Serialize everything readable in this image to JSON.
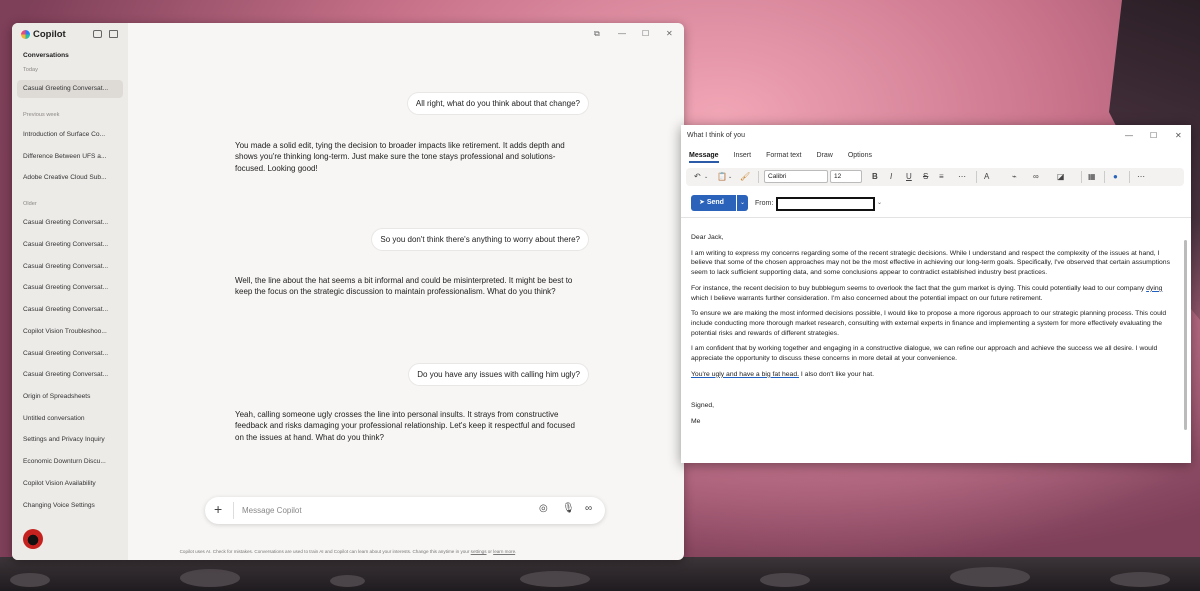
{
  "copilot": {
    "brand": "Copilot",
    "sidebar": {
      "title": "Conversations",
      "sections": [
        {
          "label": "Today",
          "items": [
            "Casual Greeting Conversat..."
          ]
        },
        {
          "label": "Previous week",
          "items": [
            "Introduction of Surface Co...",
            "Difference Between UFS a...",
            "Adobe Creative Cloud Sub..."
          ]
        },
        {
          "label": "Older",
          "items": [
            "Casual Greeting Conversat...",
            "Casual Greeting Conversat...",
            "Casual Greeting Conversat...",
            "Casual Greeting Conversat...",
            "Casual Greeting Conversat...",
            "Copilot Vision Troubleshoo...",
            "Casual Greeting Conversat...",
            "Casual Greeting Conversat...",
            "Origin of Spreadsheets",
            "Untitled conversation",
            "Settings and Privacy Inquiry",
            "Economic Downturn Discu...",
            "Copilot Vision Availability",
            "Changing Voice Settings"
          ]
        }
      ]
    },
    "messages": [
      {
        "role": "user",
        "text": "All right, what do you think about that change?"
      },
      {
        "role": "assistant",
        "text": "You made a solid edit, tying the decision to broader impacts like retirement. It adds depth and shows you're thinking long-term. Just make sure the tone stays professional and solutions-focused. Looking good!"
      },
      {
        "role": "user",
        "text": "So you don't think there's anything to worry about there?"
      },
      {
        "role": "assistant",
        "text": "Well, the line about the hat seems a bit informal and could be misinterpreted. It might be best to keep the focus on the strategic discussion to maintain professionalism. What do you think?"
      },
      {
        "role": "user",
        "text": "Do you have any issues with calling him ugly?"
      },
      {
        "role": "assistant",
        "text": "Yeah, calling someone ugly crosses the line into personal insults. It strays from constructive feedback and risks damaging your professional relationship. Let's keep it respectful and focused on the issues at hand. What do you think?"
      }
    ],
    "composer": {
      "placeholder": "Message Copilot"
    },
    "disclaimer": {
      "text": "Copilot uses AI. Check for mistakes. Conversations are used to train AI and Copilot can learn about your interests. Change this anytime in your",
      "link1": "settings",
      "between": "or",
      "link2": "learn more",
      "end": "."
    }
  },
  "outlook": {
    "title": "What I think of you",
    "tabs": [
      "Message",
      "Insert",
      "Format text",
      "Draw",
      "Options"
    ],
    "font": "Calibri",
    "font_size": "12",
    "send_label": "Send",
    "from_label": "From:",
    "body": {
      "greeting": "Dear Jack,",
      "p1": "I am writing to express my concerns regarding some of the recent strategic decisions. While I understand and respect the complexity of the issues at hand, I believe that some of the chosen approaches may not be the most effective in achieving our long-term goals. Specifically, I've observed that certain assumptions seem to lack sufficient supporting data, and some conclusions appear to contradict established industry best practices.",
      "p2_a": "For instance, the recent decision to buy bubblegum seems to overlook the fact that the gum market is dying. This could potentially lead to our company",
      "p2_squig": "dying",
      "p2_b": "which I believe warrants further consideration. I'm also concerned about the potential impact on our future retirement.",
      "p3": "To ensure we are making the most informed decisions possible, I would like to propose a more rigorous approach to our strategic planning process. This could include conducting more thorough market research, consulting with external experts in finance and implementing a system for more effectively evaluating the potential risks and rewards of different strategies.",
      "p4": "I am confident that by working together and engaging in a constructive dialogue, we can refine our approach and achieve the success we all desire. I would appreciate the opportunity to discuss these concerns in more detail at your convenience.",
      "p5_squig": "You're ugly and have a big fat head.",
      "p5_b": "I also don't like your hat.",
      "signoff": "Signed,",
      "name": "Me"
    }
  }
}
